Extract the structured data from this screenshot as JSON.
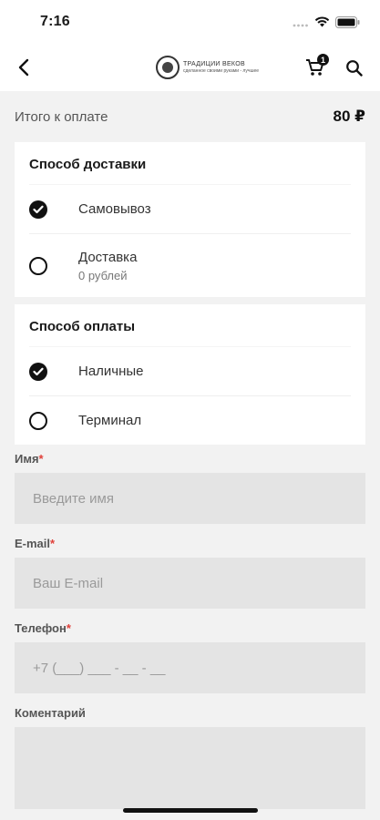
{
  "status_bar": {
    "time": "7:16",
    "icons": [
      "signal-icon",
      "wifi-icon",
      "battery-icon"
    ]
  },
  "nav": {
    "back_icon": "back-arrow-icon",
    "brand_name": "ТРАДИЦИИ ВЕКОВ",
    "brand_tagline": "сделанное своими руками - лучшее",
    "cart_icon": "cart-icon",
    "cart_count": "1",
    "search_icon": "search-icon"
  },
  "total": {
    "label": "Итого к оплате",
    "value": "80 ₽"
  },
  "delivery": {
    "title": "Способ доставки",
    "options": [
      {
        "label": "Самовывоз",
        "sublabel": "",
        "selected": true
      },
      {
        "label": "Доставка",
        "sublabel": "0 рублей",
        "selected": false
      }
    ]
  },
  "payment": {
    "title": "Способ оплаты",
    "options": [
      {
        "label": "Наличные",
        "selected": true
      },
      {
        "label": "Терминал",
        "selected": false
      }
    ]
  },
  "form": {
    "name_label": "Имя",
    "name_placeholder": "Введите имя",
    "email_label": "E-mail",
    "email_placeholder": "Ваш E-mail",
    "phone_label": "Телефон",
    "phone_placeholder": "+7 (___) ___ - __ - __",
    "comment_label": "Коментарий",
    "required_mark": "*"
  },
  "colors": {
    "accent": "#111111",
    "required": "#e0403a",
    "field_bg": "#e4e4e4",
    "page_bg": "#f2f2f2"
  }
}
